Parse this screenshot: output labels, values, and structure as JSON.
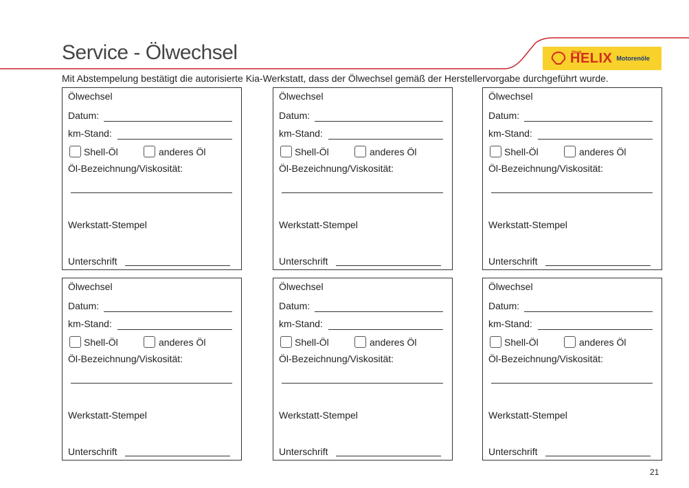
{
  "header": {
    "title": "Service - Ölwechsel",
    "intro": "Mit Abstempelung bestätigt die autorisierte Kia-Werkstatt, dass der Ölwechsel gemäß der Herstellervorgabe durchgeführt wurde."
  },
  "logo": {
    "brand": "Shell",
    "product": "HELIX",
    "subtitle": "Motorenöle",
    "bg": "#f8d12a",
    "red": "#d52b1e"
  },
  "card": {
    "title": "Ölwechsel",
    "date_label": "Datum:",
    "km_label": "km-Stand:",
    "shell_oil": "Shell-Öl",
    "other_oil": "anderes Öl",
    "oil_spec_label": "Öl-Bezeichnung/Viskosität:",
    "stamp_label": "Werkstatt-Stempel",
    "signature_label": "Unterschrift"
  },
  "cards_count": 6,
  "page_number": "21"
}
